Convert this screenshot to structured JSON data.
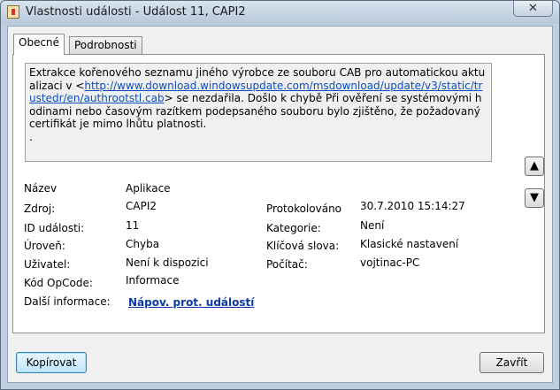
{
  "window": {
    "title": "Vlastnosti události - Událost 11, CAPI2",
    "close_glyph": "✕"
  },
  "tabs": [
    {
      "label": "Obecné"
    },
    {
      "label": "Podrobnosti"
    }
  ],
  "description": {
    "text_before": "Extrakce kořenového seznamu jiného výrobce ze souboru CAB pro automatickou aktualizaci v <",
    "url": "http://www.download.windowsupdate.com/msdownload/update/v3/static/trustedr/en/authrootstl.cab",
    "text_after": "> se nezdařila. Došlo k chybě Při ověření se systémovými hodinami nebo časovým razítkem podepsaného souboru bylo zjištěno, že požadovaný certifikát je mimo lhůtu platnosti.",
    "trailing": "."
  },
  "nav": {
    "up_glyph": "▲",
    "down_glyph": "▼"
  },
  "fields": {
    "nazev": {
      "label": "Název",
      "value": "Aplikace"
    },
    "zdroj": {
      "label": "Zdroj:",
      "value": "CAPI2"
    },
    "id": {
      "label": "ID události:",
      "value": "11"
    },
    "uroven": {
      "label": "Úroveň:",
      "value": "Chyba"
    },
    "uzivatel": {
      "label": "Uživatel:",
      "value": "Není k dispozici"
    },
    "opcode": {
      "label": "Kód OpCode:",
      "value": "Informace"
    },
    "dalsi": {
      "label": "Další informace:",
      "value": "Nápov. prot. událostí"
    },
    "protokolovano": {
      "label": "Protokolováno",
      "value": "30.7.2010 15:14:27"
    },
    "kategorie": {
      "label": "Kategorie:",
      "value": "Není"
    },
    "klicova": {
      "label": "Klíčová slova:",
      "value": "Klasické nastavení"
    },
    "pocitac": {
      "label": "Počítač:",
      "value": "vojtinac-PC"
    }
  },
  "buttons": {
    "copy": "Kopírovat",
    "close": "Zavřít"
  }
}
